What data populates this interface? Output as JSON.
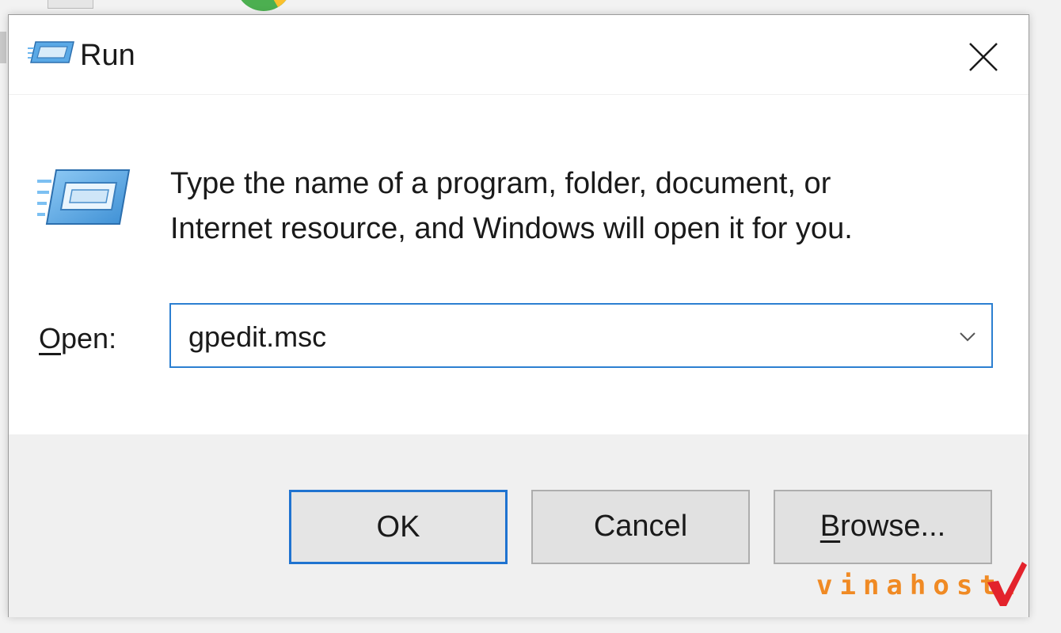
{
  "window": {
    "title": "Run",
    "close_icon": "close-icon"
  },
  "main": {
    "description_line1": "Type the name of a program, folder, document, or",
    "description_line2": "Internet resource, and Windows will open it for you.",
    "open_label_access_key": "O",
    "open_label_rest": "pen:",
    "open_input_value": "gpedit.msc"
  },
  "buttons": {
    "ok_label": "OK",
    "cancel_label": "Cancel",
    "browse_access_key": "B",
    "browse_rest": "rowse..."
  },
  "watermark": {
    "text": "vinahost."
  },
  "colors": {
    "accent": "#1f73d0",
    "footer_bg": "#f0f0f0",
    "watermark_orange": "#f08a24",
    "watermark_red": "#e3232c"
  }
}
